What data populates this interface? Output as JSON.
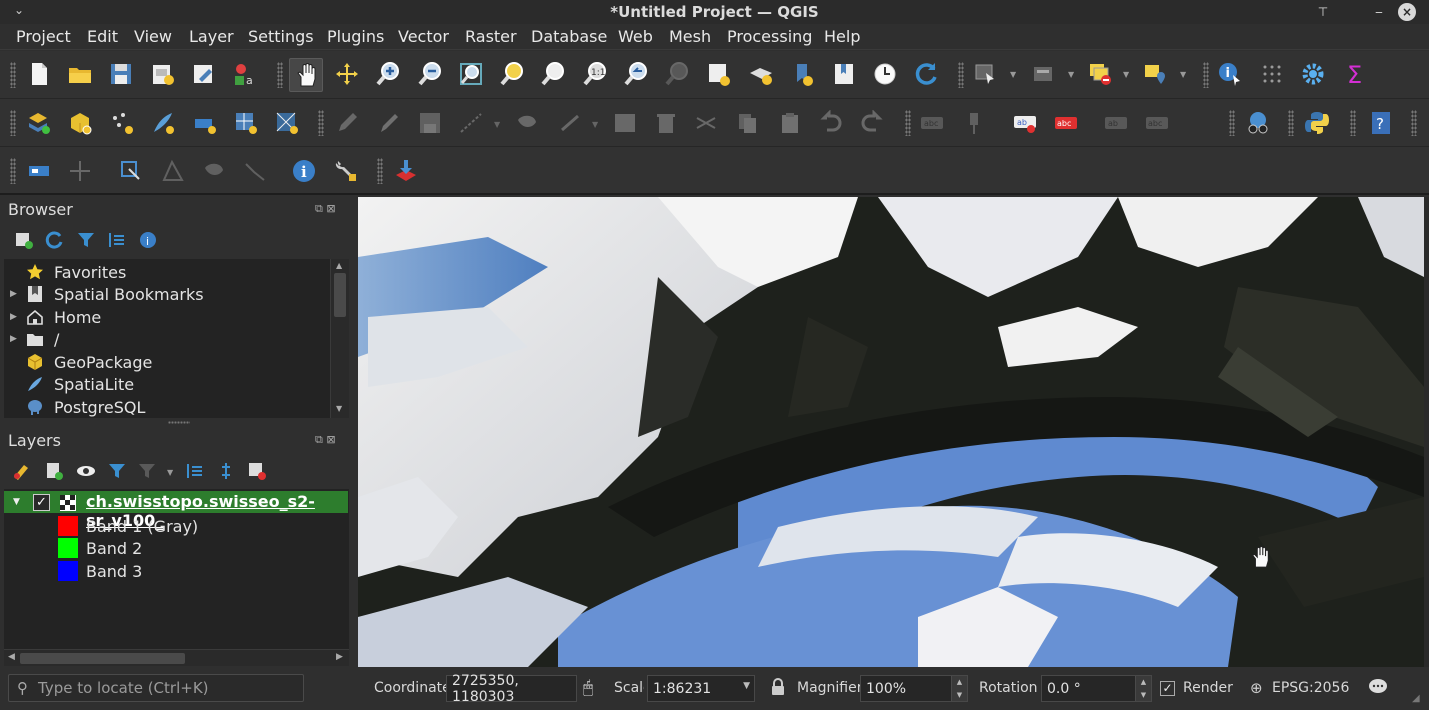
{
  "window": {
    "title": "*Untitled Project — QGIS"
  },
  "menubar": [
    "Project",
    "Edit",
    "View",
    "Layer",
    "Settings",
    "Plugins",
    "Vector",
    "Raster",
    "Database",
    "Web",
    "Mesh",
    "Processing",
    "Help"
  ],
  "browser": {
    "title": "Browser",
    "items": [
      {
        "label": "Favorites",
        "icon": "star-icon",
        "expandable": false
      },
      {
        "label": "Spatial Bookmarks",
        "icon": "bookmark-icon",
        "expandable": true
      },
      {
        "label": "Home",
        "icon": "home-icon",
        "expandable": true
      },
      {
        "label": "/",
        "icon": "folder-icon",
        "expandable": true
      },
      {
        "label": "GeoPackage",
        "icon": "geopackage-icon",
        "expandable": false
      },
      {
        "label": "SpatiaLite",
        "icon": "spatialite-icon",
        "expandable": false
      },
      {
        "label": "PostgreSQL",
        "icon": "postgresql-icon",
        "expandable": false
      }
    ]
  },
  "layers": {
    "title": "Layers",
    "layer_name": "ch.swisstopo.swisseo_s2-sr_v100_",
    "checked": true,
    "bands": [
      {
        "label": "Band 1 (Gray)",
        "color": "#ff0000"
      },
      {
        "label": "Band 2",
        "color": "#00ff00"
      },
      {
        "label": "Band 3",
        "color": "#0000ff"
      }
    ]
  },
  "status": {
    "locator_placeholder": "Type to locate (Ctrl+K)",
    "coordinate_label": "Coordinate",
    "coordinate_value": "2725350, 1180303",
    "scale_label": "Scale",
    "scale_value": "1:86231",
    "magnifier_label": "Magnifier",
    "magnifier_value": "100%",
    "rotation_label": "Rotation",
    "rotation_value": "0.0 °",
    "render_label": "Render",
    "render_checked": true,
    "crs": "EPSG:2056"
  },
  "colors": {
    "accent": "#2d7d2d",
    "background": "#2f2f2f",
    "tree_bg": "#232323"
  }
}
